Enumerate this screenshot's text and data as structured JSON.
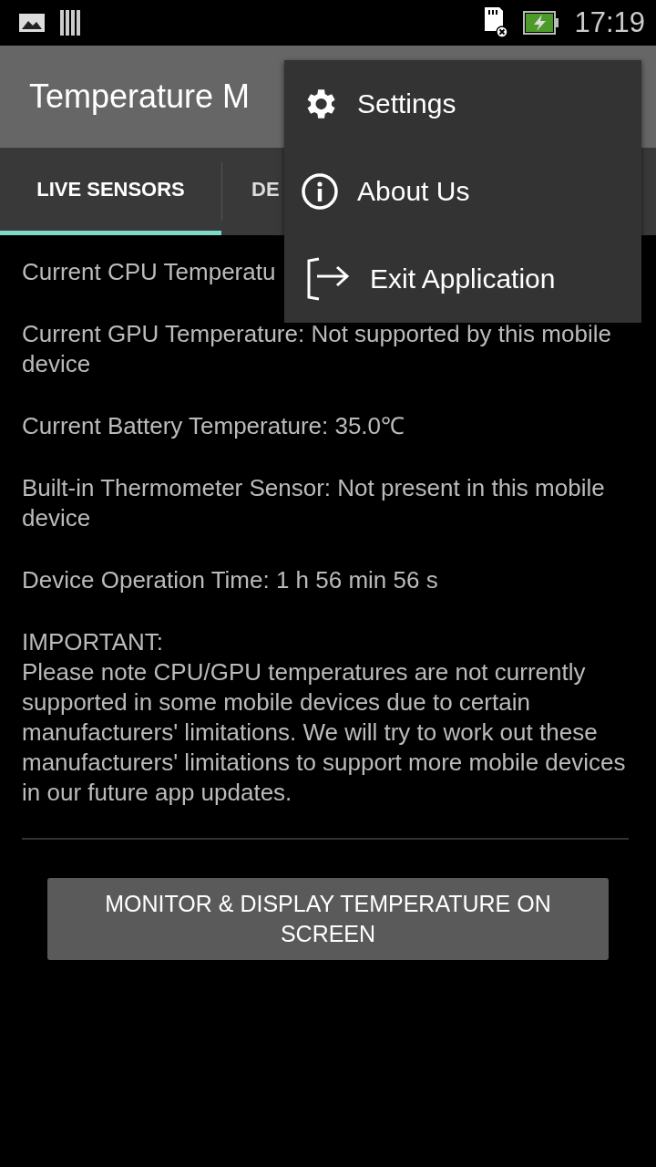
{
  "status_bar": {
    "time": "17:19"
  },
  "app_bar": {
    "title": "Temperature M"
  },
  "tabs": [
    {
      "label": "LIVE SENSORS",
      "selected": true
    },
    {
      "label": "DE",
      "selected": false
    }
  ],
  "readings": [
    "Current CPU Temperatu",
    "Current GPU Temperature: Not supported by this mobile device",
    "Current Battery Temperature: 35.0℃",
    "Built-in Thermometer Sensor: Not present in this mobile device",
    "Device Operation Time: 1 h 56 min 56 s"
  ],
  "notice": {
    "heading": "IMPORTANT:",
    "body": "Please note CPU/GPU temperatures are not currently supported in some mobile devices due to certain manufacturers' limitations. We will try to work out these manufacturers' limitations to support more mobile devices in our future app updates."
  },
  "action_button": "MONITOR & DISPLAY TEMPERATURE ON SCREEN",
  "menu": [
    {
      "kind": "settings",
      "label": "Settings"
    },
    {
      "kind": "about",
      "label": "About Us"
    },
    {
      "kind": "exit",
      "label": "Exit Application"
    }
  ]
}
